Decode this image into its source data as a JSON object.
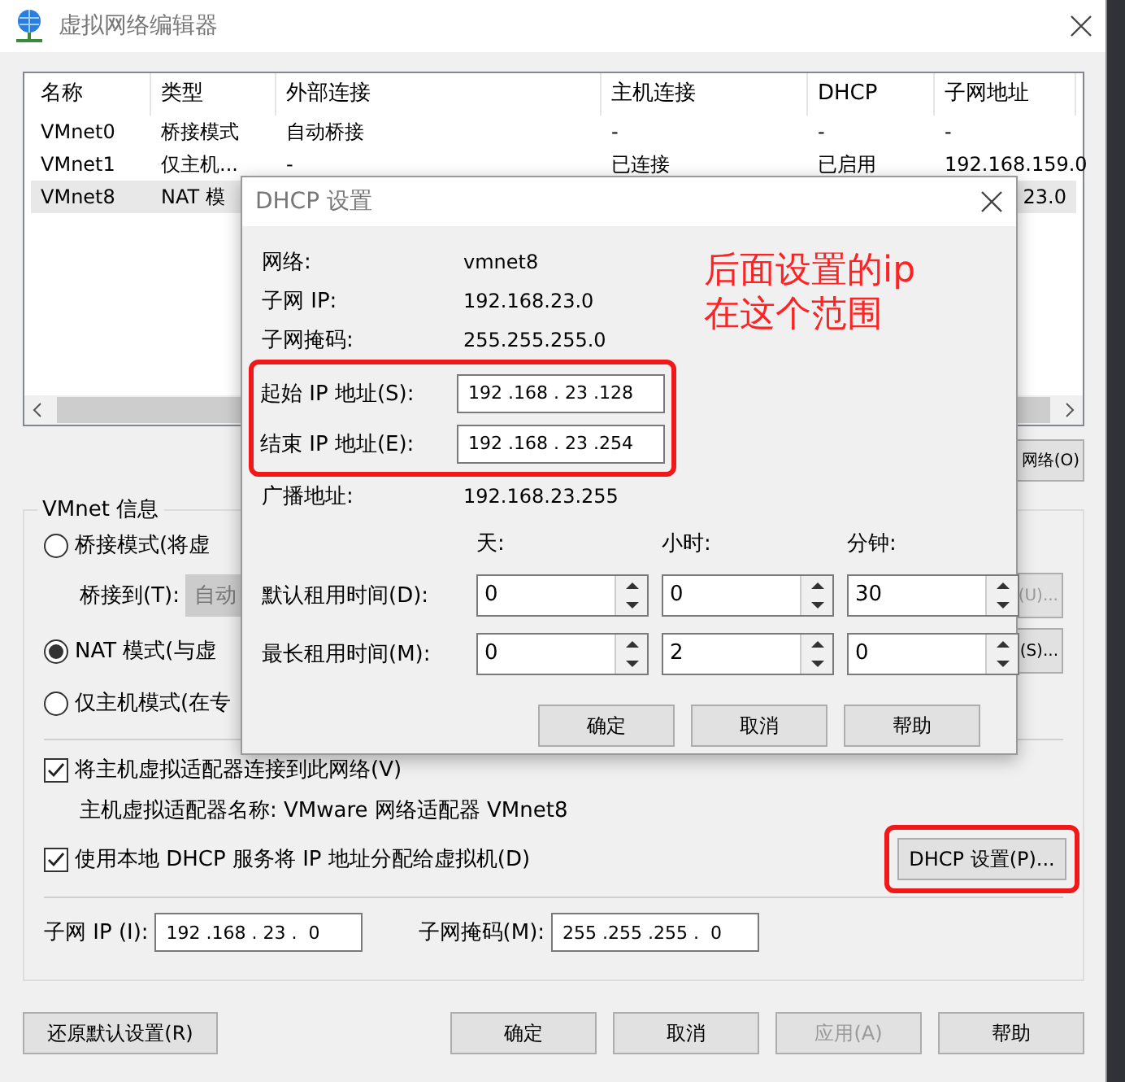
{
  "window": {
    "title": "虚拟网络编辑器"
  },
  "table": {
    "columns": [
      "名称",
      "类型",
      "外部连接",
      "主机连接",
      "DHCP",
      "子网地址"
    ],
    "rows": [
      {
        "name": "VMnet0",
        "type": "桥接模式",
        "external": "自动桥接",
        "host": "-",
        "dhcp": "-",
        "subnet": "-",
        "selected": false,
        "covered": false
      },
      {
        "name": "VMnet1",
        "type": "仅主机...",
        "external": "-",
        "host": "已连接",
        "dhcp": "已启用",
        "subnet": "192.168.159.0",
        "selected": false,
        "covered": false
      },
      {
        "name": "VMnet8",
        "type": "NAT 模",
        "subnet": "23.0",
        "selected": true,
        "covered": true
      }
    ]
  },
  "remove_button": "网络(O)",
  "vmnet_info": {
    "legend": "VMnet 信息",
    "modes": [
      {
        "label": "桥接模式(将虚",
        "selected": false
      },
      {
        "label": "NAT 模式(与虚",
        "selected": true
      },
      {
        "label": "仅主机模式(在专",
        "selected": false
      }
    ],
    "bridge_to": {
      "label": "桥接到(T):",
      "value": "自动",
      "disabled": true
    },
    "auto_button": {
      "label": "(U)...",
      "disabled": true
    },
    "nat_button": {
      "label": "(S)...",
      "disabled": false
    },
    "connect_adapter": {
      "label": "将主机虚拟适配器连接到此网络(V)",
      "checked": true
    },
    "adapter_name": "主机虚拟适配器名称: VMware 网络适配器 VMnet8",
    "use_dhcp": {
      "label": "使用本地 DHCP 服务将 IP 地址分配给虚拟机(D)",
      "checked": true
    },
    "dhcp_button": {
      "label": "DHCP 设置(P)...",
      "highlighted": true
    },
    "subnet_ip": {
      "label": "子网 IP (I):",
      "value": "192 .168 . 23 .  0"
    },
    "subnet_mask": {
      "label": "子网掩码(M):",
      "value": "255 .255 .255 .  0"
    }
  },
  "footer_buttons": [
    {
      "label": "还原默认设置(R)",
      "disabled": false
    },
    {
      "label": "确定",
      "disabled": false
    },
    {
      "label": "取消",
      "disabled": false
    },
    {
      "label": "应用(A)",
      "disabled": true
    },
    {
      "label": "帮助",
      "disabled": false
    }
  ],
  "dhcp_dialog": {
    "title": "DHCP 设置",
    "info": [
      {
        "label": "网络:",
        "value": "vmnet8"
      },
      {
        "label": "子网 IP:",
        "value": "192.168.23.0"
      },
      {
        "label": "子网掩码:",
        "value": "255.255.255.0"
      }
    ],
    "range_highlighted": true,
    "range": [
      {
        "label": "起始 IP 地址(S):",
        "value": "192 .168 . 23 .128"
      },
      {
        "label": "结束 IP 地址(E):",
        "value": "192 .168 . 23 .254"
      }
    ],
    "broadcast": {
      "label": "广播地址:",
      "value": "192.168.23.255"
    },
    "lease_units": [
      "天:",
      "小时:",
      "分钟:"
    ],
    "leases": [
      {
        "label": "默认租用时间(D):",
        "values": [
          "0",
          "0",
          "30"
        ]
      },
      {
        "label": "最长租用时间(M):",
        "values": [
          "0",
          "2",
          "0"
        ]
      }
    ],
    "buttons": [
      "确定",
      "取消",
      "帮助"
    ]
  },
  "annotation": {
    "lines": [
      "后面设置的ip",
      "在这个范围"
    ]
  }
}
